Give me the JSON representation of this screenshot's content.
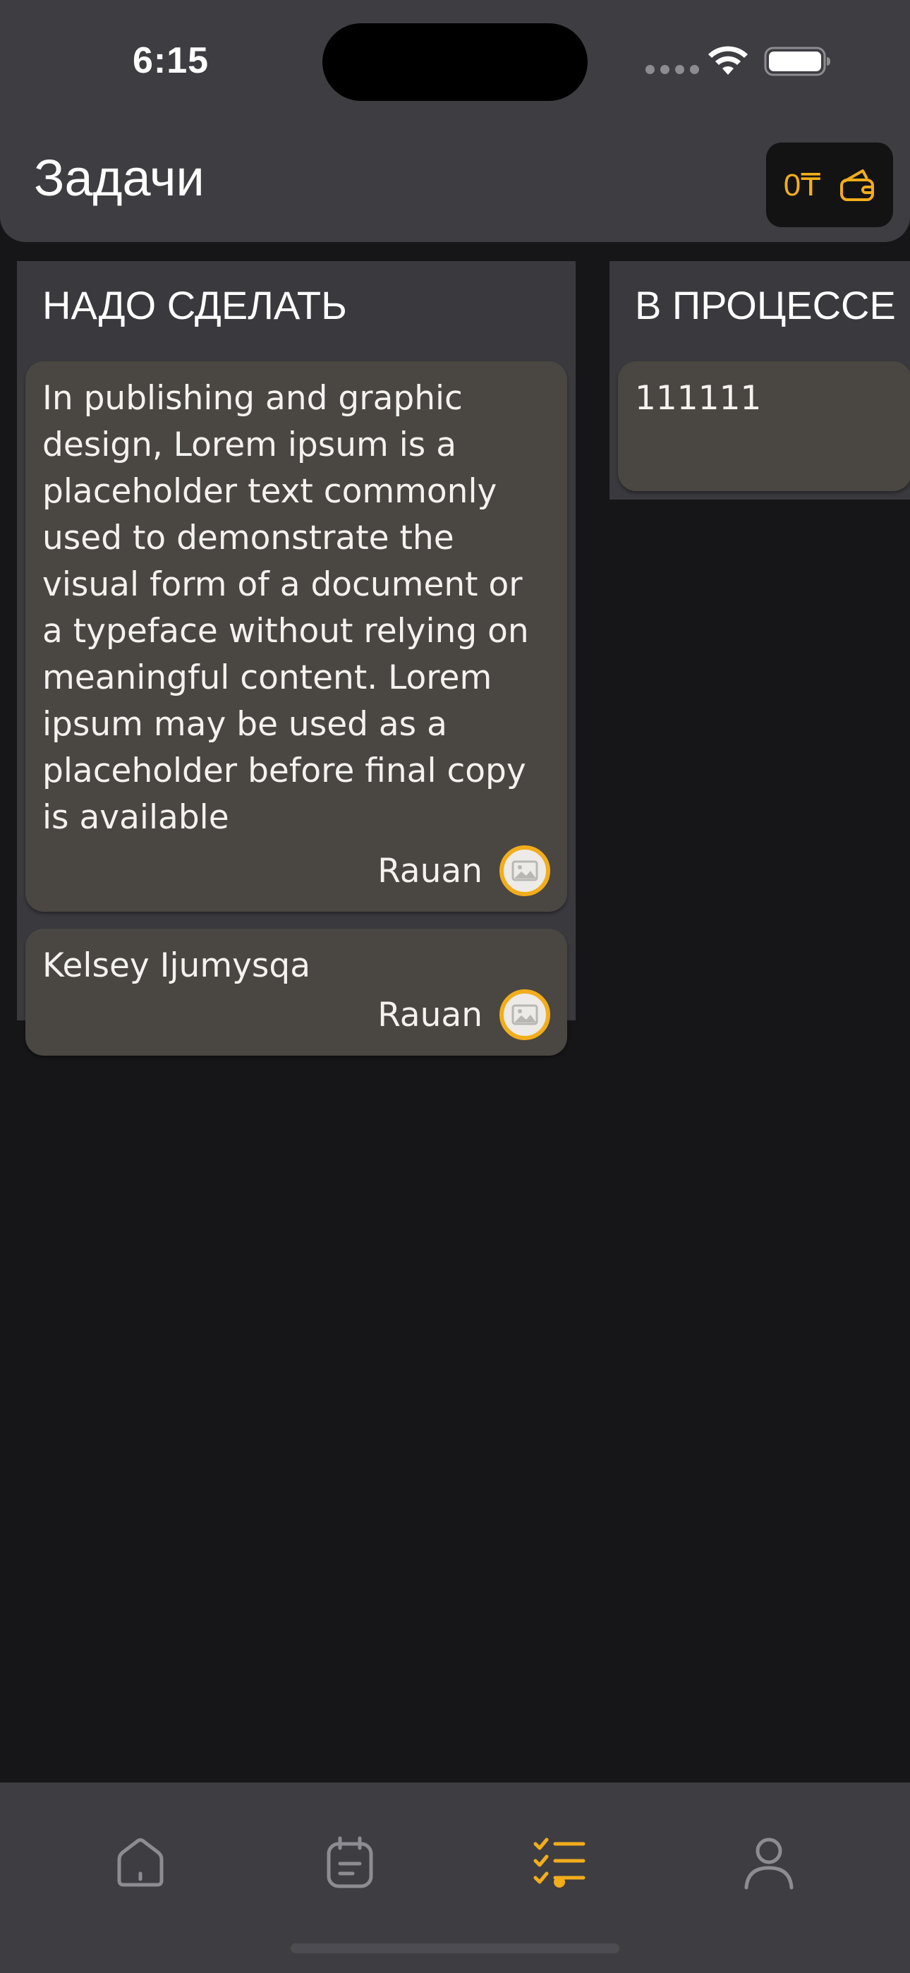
{
  "status_bar": {
    "time": "6:15"
  },
  "header": {
    "title": "Задачи",
    "wallet_amount": "0₸",
    "wallet_icon": "wallet-icon"
  },
  "columns": [
    {
      "title": "НАДО СДЕЛАТЬ",
      "cards": [
        {
          "text": "In publishing and graphic design, Lorem ipsum is a placeholder text commonly used to demonstrate the visual form of a document or a typeface without relying on meaningful content. Lorem ipsum may be used as a placeholder before final copy is available",
          "assignee": "Rauan"
        },
        {
          "text": "Kelsey Ijumysqa",
          "assignee": "Rauan"
        }
      ]
    },
    {
      "title": "В ПРОЦЕССЕ",
      "cards": [
        {
          "text": "111111"
        }
      ]
    }
  ],
  "tabbar": {
    "tabs": [
      "home-icon",
      "calendar-note-icon",
      "task-list-icon",
      "profile-icon"
    ],
    "active_tab": 2
  },
  "colors": {
    "accent": "#f2ad1b",
    "header_bg": "#3e3d42",
    "column_bg": "#3a393e",
    "card_bg": "#4a4641",
    "screen_bg": "#161618"
  }
}
